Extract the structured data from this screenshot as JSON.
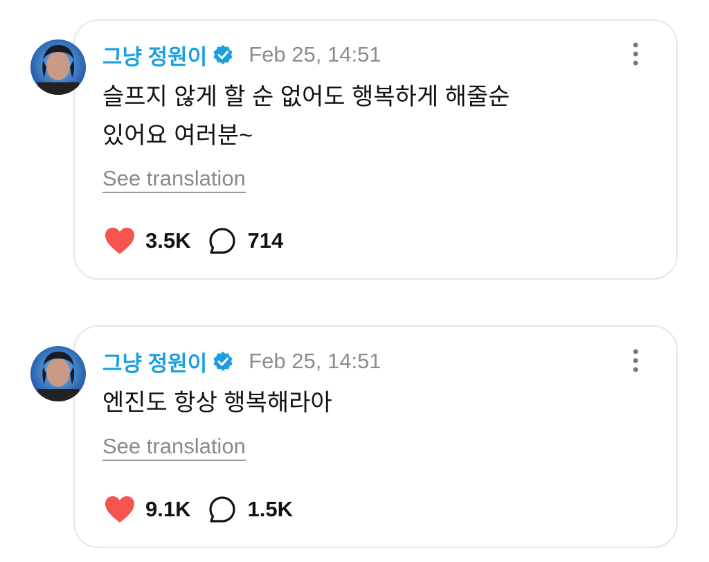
{
  "posts": [
    {
      "username": "그냥 정원이",
      "timestamp": "Feb 25, 14:51",
      "text_lines": [
        "슬프지 않게 할 순 없어도 행복하게 해줄순",
        "있어요 여러분~"
      ],
      "translate_label": "See translation",
      "likes": "3.5K",
      "replies": "714"
    },
    {
      "username": "그냥 정원이",
      "timestamp": "Feb 25, 14:51",
      "text_lines": [
        "엔진도 항상 행복해라아"
      ],
      "translate_label": "See translation",
      "likes": "9.1K",
      "replies": "1.5K"
    }
  ],
  "colors": {
    "username": "#1a9fe0",
    "verified": "#1a9fe0",
    "heart": "#f5544f",
    "muted": "#8c8c8c",
    "border": "#e6e6ea"
  },
  "icons": {
    "verified": "verified-badge-icon",
    "more": "more-vertical-icon",
    "like": "heart-icon",
    "reply": "speech-bubble-icon"
  }
}
